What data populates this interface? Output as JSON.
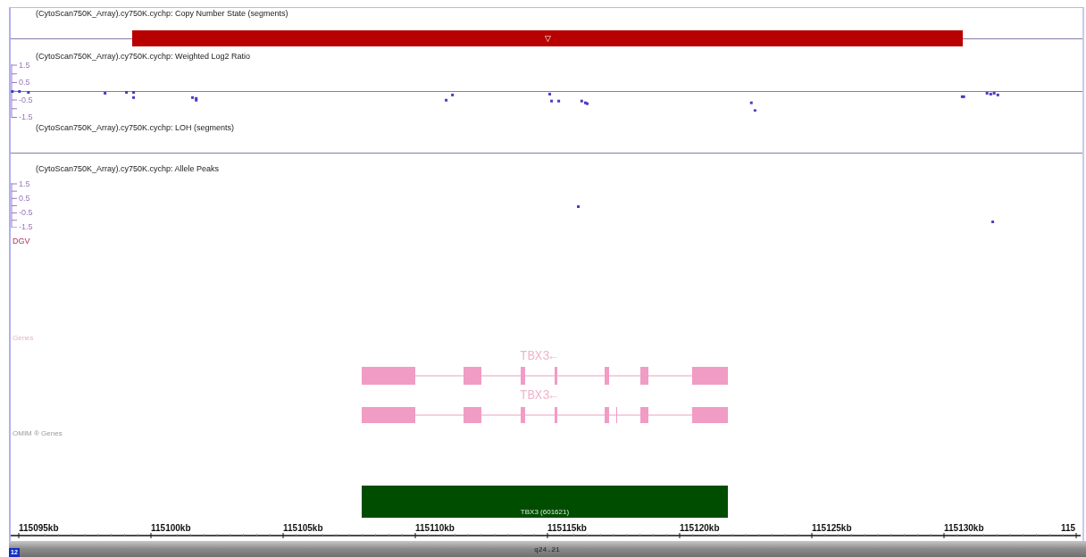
{
  "copy_number_track": {
    "label": "(CytoScan750K_Array).cy750K.cychp: Copy Number State (segments)",
    "segment_marker": "▽"
  },
  "log2_track": {
    "label": "(CytoScan750K_Array).cy750K.cychp: Weighted Log2 Ratio",
    "axis_labels": [
      "1.5",
      "0.5",
      "-0.5",
      "-1.5"
    ]
  },
  "loh_track": {
    "label": "(CytoScan750K_Array).cy750K.cychp: LOH (segments)"
  },
  "allele_track": {
    "label": "(CytoScan750K_Array).cy750K.cychp: Allele Peaks",
    "axis_labels": [
      "1.5",
      "0.5",
      "-0.5",
      "-1.5"
    ]
  },
  "dgv_track": {
    "label": "DGV"
  },
  "genes_track": {
    "label": "Genes",
    "transcripts": [
      {
        "label": "TBX3←"
      },
      {
        "label": "TBX3←"
      }
    ]
  },
  "omim_track": {
    "label": "OMIM ® Genes",
    "features": [
      {
        "label": "TBX3 (601621)"
      }
    ]
  },
  "ruler": {
    "labels": [
      "115095kb",
      "115100kb",
      "115105kb",
      "115110kb",
      "115115kb",
      "115120kb",
      "115125kb",
      "115130kb",
      "115"
    ]
  },
  "ideogram": {
    "chromosome": "12",
    "band": "q24.21"
  }
}
